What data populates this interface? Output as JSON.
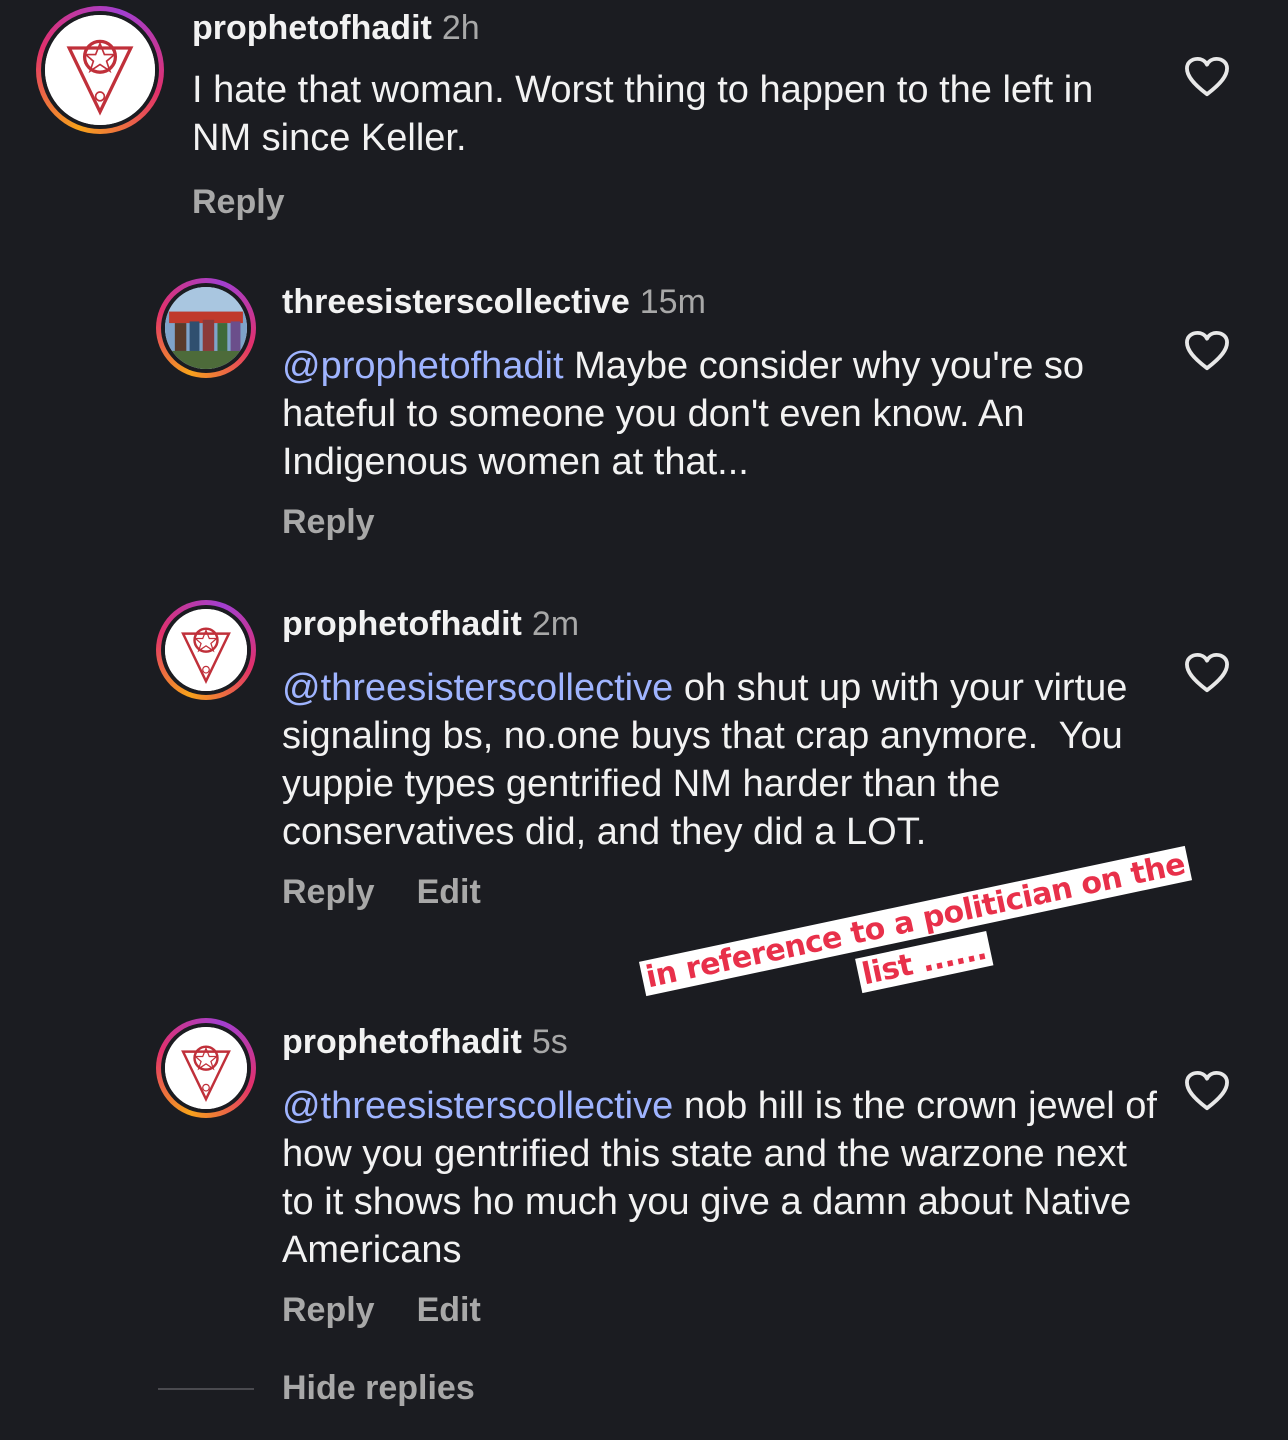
{
  "comments": [
    {
      "username": "prophetofhadit",
      "time": "2h",
      "mention": "",
      "text": "I hate that woman. Worst thing to happen to the left in NM since Keller.",
      "actions": [
        "Reply"
      ]
    },
    {
      "username": "threesisterscollective",
      "time": "15m",
      "mention": "@prophetofhadit",
      "text": " Maybe consider why you're so hateful to someone you don't even know. An Indigenous women at that...",
      "actions": [
        "Reply"
      ]
    },
    {
      "username": "prophetofhadit",
      "time": "2m",
      "mention": "@threesisterscollective",
      "text": " oh shut up with your virtue signaling bs, no.one buys that crap anymore.  You yuppie types gentrified NM harder than the conservatives did, and they did a LOT.",
      "actions": [
        "Reply",
        "Edit"
      ]
    },
    {
      "username": "prophetofhadit",
      "time": "5s",
      "mention": "@threesisterscollective",
      "text": " nob hill is the crown jewel of how you gentrified this state and the warzone next to it shows ho much you give a damn about Native Americans",
      "actions": [
        "Reply",
        "Edit"
      ]
    }
  ],
  "annotation": "in reference to a politician on the list ......",
  "hide_replies": "Hide replies",
  "icons": {
    "like": "heart-outline-icon",
    "avatar_prophet": "pentagram-logo",
    "avatar_threesisters": "group-photo"
  }
}
